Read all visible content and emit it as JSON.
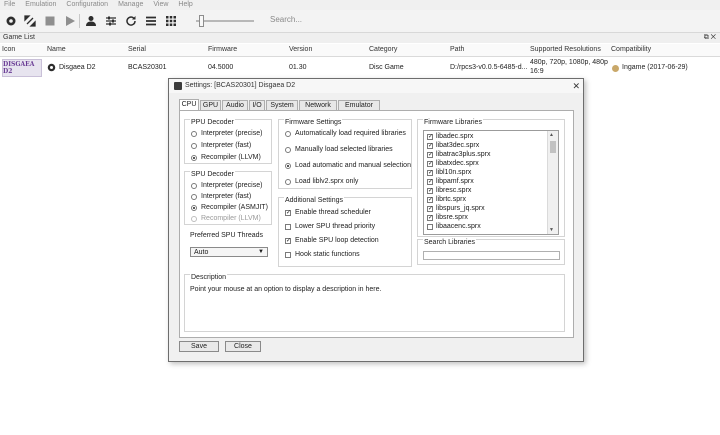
{
  "menu": [
    "File",
    "Emulation",
    "Configuration",
    "Manage",
    "View",
    "Help"
  ],
  "toolbar": {
    "icons": [
      "settings-icon",
      "fullscreen-icon",
      "stop-icon",
      "play-icon",
      "user-icon",
      "controls-icon",
      "refresh-icon",
      "list-view-icon",
      "grid-view-icon"
    ],
    "search_placeholder": "Search..."
  },
  "game_list": {
    "title": "Game List",
    "window_controls": "⧉ ✕",
    "columns": [
      "Icon",
      "Name",
      "Serial",
      "Firmware",
      "Version",
      "Category",
      "Path",
      "Supported Resolutions",
      "Compatibility"
    ],
    "rows": [
      {
        "icon_text": "DISGAEA D2",
        "name": "Disgaea D2",
        "serial": "BCAS20301",
        "firmware": "04.5000",
        "version": "01.30",
        "category": "Disc Game",
        "path": "D:/rpcs3-v0.0.5-6485-d...",
        "resolutions_line1": "480p, 720p, 1080p, 480p",
        "resolutions_line2": "16:9",
        "compatibility": "Ingame (2017-06-29)",
        "compat_color": "#c9a86a"
      }
    ]
  },
  "dialog": {
    "title": "Settings: [BCAS20301] Disgaea D2",
    "close": "✕",
    "tabs": [
      "CPU",
      "GPU",
      "Audio",
      "I/O",
      "System",
      "Network",
      "Emulator"
    ],
    "ppu": {
      "title": "PPU Decoder",
      "options": [
        "Interpreter (precise)",
        "Interpreter (fast)",
        "Recompiler (LLVM)"
      ],
      "selected": 2
    },
    "spu": {
      "title": "SPU Decoder",
      "options": [
        "Interpreter (precise)",
        "Interpreter (fast)",
        "Recompiler (ASMJIT)",
        "Recompiler (LLVM)"
      ],
      "selected": 2
    },
    "spu_threads": {
      "title": "Preferred SPU Threads",
      "value": "Auto"
    },
    "firmware_settings": {
      "title": "Firmware Settings",
      "options": [
        "Automatically load required libraries",
        "Manually load selected libraries",
        "Load automatic and manual selection",
        "Load liblv2.sprx only"
      ],
      "selected": 2
    },
    "additional": {
      "title": "Additional Settings",
      "options": [
        {
          "label": "Enable thread scheduler",
          "checked": true
        },
        {
          "label": "Lower SPU thread priority",
          "checked": false
        },
        {
          "label": "Enable SPU loop detection",
          "checked": true
        },
        {
          "label": "Hook static functions",
          "checked": false
        }
      ]
    },
    "firmware_libraries": {
      "title": "Firmware Libraries",
      "items": [
        "libadec.sprx",
        "libat3dec.sprx",
        "libatrac3plus.sprx",
        "libatxdec.sprx",
        "libl10n.sprx",
        "libpamf.sprx",
        "libresc.sprx",
        "librtc.sprx",
        "libspurs_jq.sprx",
        "libsre.sprx",
        "libaacenc.sprx"
      ],
      "checked": [
        true,
        true,
        true,
        true,
        true,
        true,
        true,
        true,
        true,
        true,
        false
      ]
    },
    "search_libraries": {
      "title": "Search Libraries"
    },
    "description": {
      "title": "Description",
      "text": "Point your mouse at an option to display a description in here."
    },
    "buttons": {
      "save": "Save",
      "close": "Close"
    }
  }
}
